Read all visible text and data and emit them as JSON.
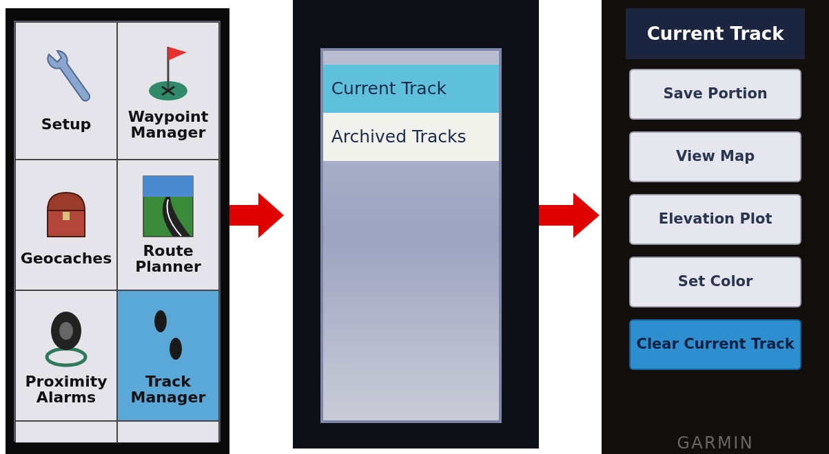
{
  "main_menu": {
    "tiles": [
      {
        "label": "Setup",
        "selected": false
      },
      {
        "label": "Waypoint Manager",
        "selected": false
      },
      {
        "label": "Geocaches",
        "selected": false
      },
      {
        "label": "Route Planner",
        "selected": false
      },
      {
        "label": "Proximity Alarms",
        "selected": false
      },
      {
        "label": "Track Manager",
        "selected": true
      }
    ]
  },
  "track_manager": {
    "items": [
      {
        "label": "Current Track",
        "selected": true
      },
      {
        "label": "Archived Tracks",
        "selected": false
      }
    ]
  },
  "current_track": {
    "title": "Current Track",
    "buttons": [
      {
        "label": "Save Portion",
        "selected": false
      },
      {
        "label": "View Map",
        "selected": false
      },
      {
        "label": "Elevation Plot",
        "selected": false
      },
      {
        "label": "Set Color",
        "selected": false
      },
      {
        "label": "Clear Current Track",
        "selected": true
      }
    ],
    "device_label": "GARMIN"
  }
}
